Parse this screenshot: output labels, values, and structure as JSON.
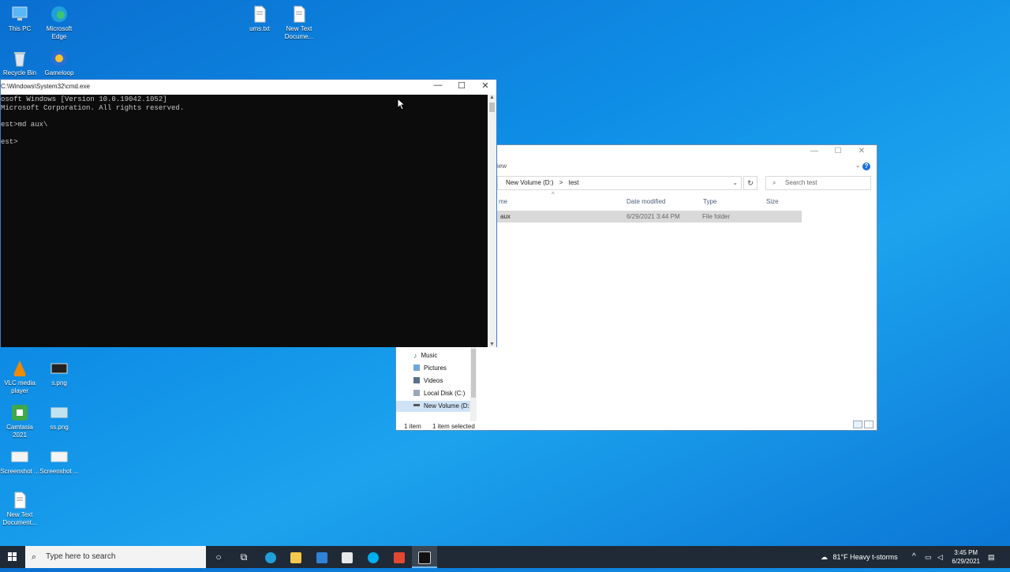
{
  "desktop": {
    "icons": [
      {
        "label": "This PC",
        "icon": "computer-icon"
      },
      {
        "label": "Microsoft Edge",
        "icon": "edge-icon"
      },
      {
        "label": "ums.txt",
        "icon": "text-file-icon"
      },
      {
        "label": "New Text Docume...",
        "icon": "text-file-icon"
      },
      {
        "label": "Recycle Bin",
        "icon": "recycle-bin-icon"
      },
      {
        "label": "Gameloop",
        "icon": "gameloop-icon"
      },
      {
        "label": "VLC media player",
        "icon": "vlc-icon"
      },
      {
        "label": "s.png",
        "icon": "image-file-icon"
      },
      {
        "label": "Camtasia 2021",
        "icon": "camtasia-icon"
      },
      {
        "label": "ss.png",
        "icon": "image-file-icon"
      },
      {
        "label": "Screenshot ...",
        "icon": "image-file-icon"
      },
      {
        "label": "Screenshot ...",
        "icon": "image-file-icon"
      },
      {
        "label": "New Text Document...",
        "icon": "text-file-icon"
      }
    ]
  },
  "cmd": {
    "title": "C:\\Windows\\System32\\cmd.exe",
    "lines": [
      "osoft Windows [Version 10.0.19042.1052]",
      "Microsoft Corporation. All rights reserved.",
      "",
      "est>md aux\\",
      "",
      "est>"
    ]
  },
  "explorer": {
    "menu_partial": "iew",
    "address": {
      "part1": "New Volume (D:)",
      "sep": ">",
      "part2": "test"
    },
    "search_placeholder": "Search test",
    "columns": {
      "name": "me",
      "date": "Date modified",
      "type": "Type",
      "size": "Size"
    },
    "rows": [
      {
        "name": "aux",
        "date": "6/29/2021 3:44 PM",
        "type": "File folder",
        "size": ""
      }
    ],
    "nav": [
      {
        "label": "Music",
        "icon": "music-icon"
      },
      {
        "label": "Pictures",
        "icon": "pictures-icon"
      },
      {
        "label": "Videos",
        "icon": "videos-icon"
      },
      {
        "label": "Local Disk (C:)",
        "icon": "disk-icon"
      },
      {
        "label": "New Volume (D:",
        "icon": "drive-icon"
      }
    ],
    "status": {
      "count": "1 item",
      "selected": "1 item selected"
    }
  },
  "taskbar": {
    "search_placeholder": "Type here to search",
    "weather": "81°F  Heavy t-storms",
    "time": "3:45 PM",
    "date": "6/29/2021"
  },
  "colors": {
    "accent": "#0078d7",
    "console_bg": "#0c0c0c",
    "taskbar_bg": "#1f2a36"
  }
}
